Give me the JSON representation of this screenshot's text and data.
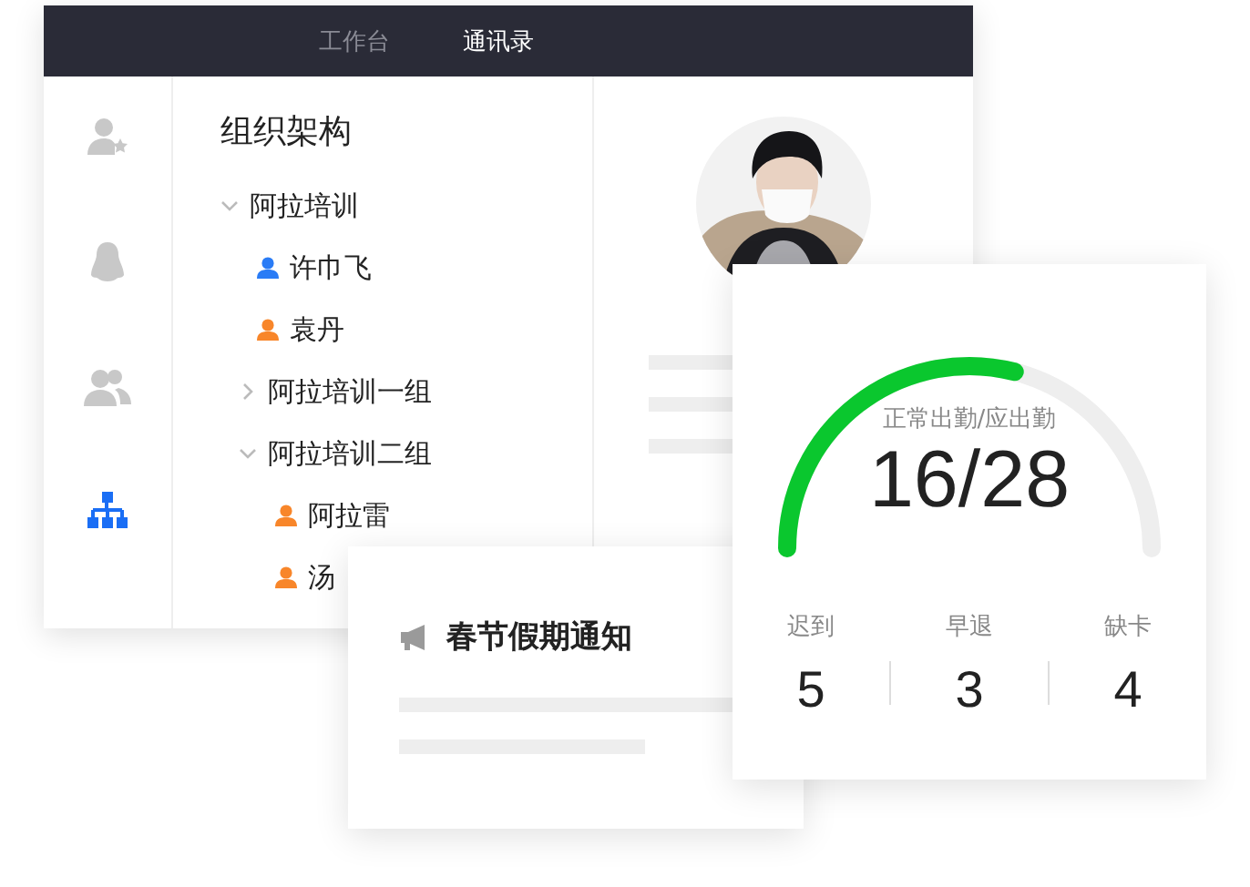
{
  "header": {
    "tabs": [
      {
        "label": "工作台",
        "selected": false
      },
      {
        "label": "通讯录",
        "selected": true
      }
    ]
  },
  "sidebar": {
    "items": [
      {
        "kind": "starred",
        "selected": false
      },
      {
        "kind": "penguin",
        "selected": false
      },
      {
        "kind": "group",
        "selected": false
      },
      {
        "kind": "org",
        "selected": true
      }
    ]
  },
  "tree": {
    "title": "组织架构",
    "nodes": [
      {
        "kind": "group",
        "label": "阿拉培训",
        "expanded": true,
        "children": [
          {
            "kind": "person",
            "label": "许巾飞",
            "color": "#2a7cf6"
          },
          {
            "kind": "person",
            "label": "袁丹",
            "color": "#f8862a"
          },
          {
            "kind": "group",
            "label": "阿拉培训一组",
            "expanded": false
          },
          {
            "kind": "group",
            "label": "阿拉培训二组",
            "expanded": true,
            "children": [
              {
                "kind": "person",
                "label": "阿拉雷",
                "color": "#f8862a"
              },
              {
                "kind": "person",
                "label": "汤",
                "color": "#f8862a"
              }
            ]
          }
        ]
      }
    ]
  },
  "notice": {
    "title": "春节假期通知"
  },
  "attendance": {
    "caption": "正常出勤/应出勤",
    "value": "16/28",
    "stats": [
      {
        "label": "迟到",
        "value": "5"
      },
      {
        "label": "早退",
        "value": "3"
      },
      {
        "label": "缺卡",
        "value": "4"
      }
    ]
  }
}
